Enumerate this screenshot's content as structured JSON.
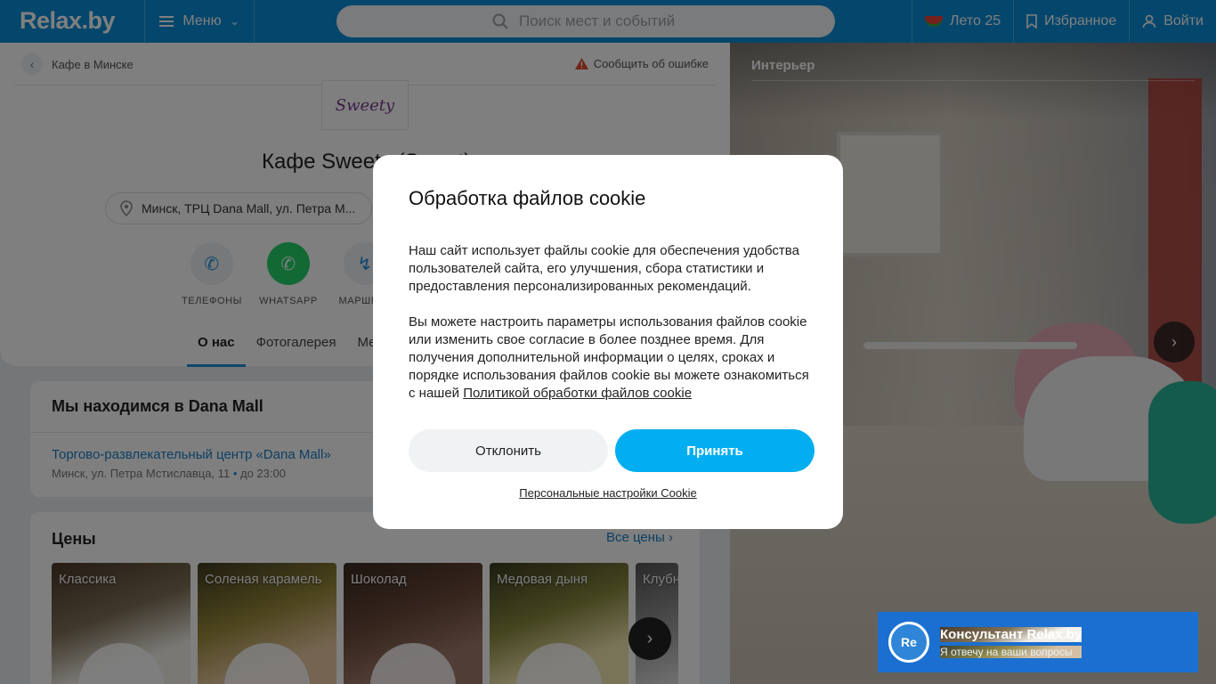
{
  "header": {
    "logo": "Relax.by",
    "menu_label": "Меню",
    "search_placeholder": "Поиск мест и событий",
    "summer_label": "Лето 25",
    "favorites_label": "Избранное",
    "login_label": "Войти"
  },
  "place": {
    "breadcrumb": "Кафе в Минске",
    "report_label": "Сообщить об ошибке",
    "logo_text": "Sweety",
    "title": "Кафе Sweety (Sweet)",
    "address": "Минск, ТРЦ Dana Mall, ул. Петра М...",
    "actions": [
      {
        "label": "ТЕЛЕФОНЫ"
      },
      {
        "label": "WHATSAPP"
      },
      {
        "label": "МАРШРУТ"
      }
    ],
    "tabs": [
      {
        "label": "О нас"
      },
      {
        "label": "Фотогалерея"
      },
      {
        "label": "Меню"
      }
    ]
  },
  "location": {
    "title": "Мы находимся в Dana Mall",
    "link": "Торгово-развлекательный центр «Dana Mall»",
    "address": "Минск, ул. Петра Мстиславца, 11",
    "separator": "•",
    "hours": "до 23:00"
  },
  "prices": {
    "title": "Цены",
    "all_label": "Все цены",
    "items": [
      {
        "label": "Классика"
      },
      {
        "label": "Соленая карамель"
      },
      {
        "label": "Шоколад"
      },
      {
        "label": "Медовая дыня"
      },
      {
        "label": "Клубника"
      }
    ]
  },
  "photo": {
    "label": "Интерьер"
  },
  "cookie": {
    "title": "Обработка файлов cookie",
    "paragraph1": "Наш сайт использует файлы cookie для обеспечения удобства пользователей сайта, его улучшения, сбора статистики и предоставления персонализированных рекомендаций.",
    "paragraph2": "Вы можете настроить параметры использования файлов cookie или изменить свое согласие в более позднее время. Для получения дополнительной информации о целях, сроках и порядке использования файлов cookie вы можете ознакомиться с нашей ",
    "policy_link": "Политикой обработки файлов cookie",
    "decline_label": "Отклонить",
    "accept_label": "Принять",
    "settings_label": "Персональные настройки Cookie"
  },
  "consultant": {
    "avatar": "Re",
    "title": "Консультант Relax.by",
    "subtitle": "Я отвечу на ваши вопросы"
  },
  "colors": {
    "header_bg": "#0a8fd8",
    "accept_bg": "#03aef0",
    "whatsapp": "#25d366",
    "consultant_bg": "#1a6fd0"
  }
}
